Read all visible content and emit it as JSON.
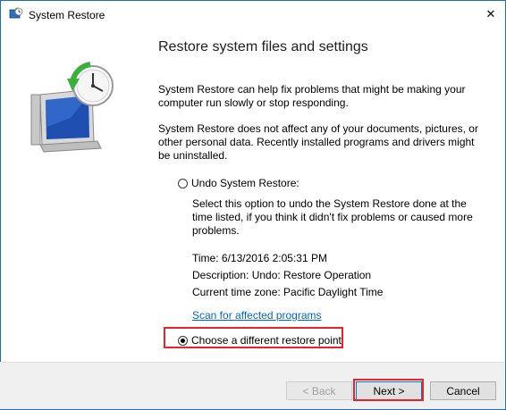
{
  "window": {
    "title": "System Restore",
    "close_glyph": "✕"
  },
  "main": {
    "heading": "Restore system files and settings",
    "para1": "System Restore can help fix problems that might be making your computer run slowly or stop responding.",
    "para2": "System Restore does not affect any of your documents, pictures, or other personal data. Recently installed programs and drivers might be uninstalled.",
    "undo_option": {
      "label": "Undo System Restore:",
      "selected": false,
      "description": "Select this option to undo the System Restore done at the time listed, if you think it didn't fix problems or caused more problems.",
      "time": "Time: 6/13/2016 2:05:31 PM",
      "desc_line": "Description: Undo: Restore Operation",
      "timezone": "Current time zone: Pacific Daylight Time",
      "scan_link": "Scan for affected programs"
    },
    "different_option": {
      "label": "Choose a different restore point",
      "selected": true
    }
  },
  "buttons": {
    "back": "< Back",
    "next": "Next >",
    "cancel": "Cancel"
  },
  "colors": {
    "accent": "#0078d7",
    "highlight": "#e8232a",
    "link": "#0066cc"
  }
}
